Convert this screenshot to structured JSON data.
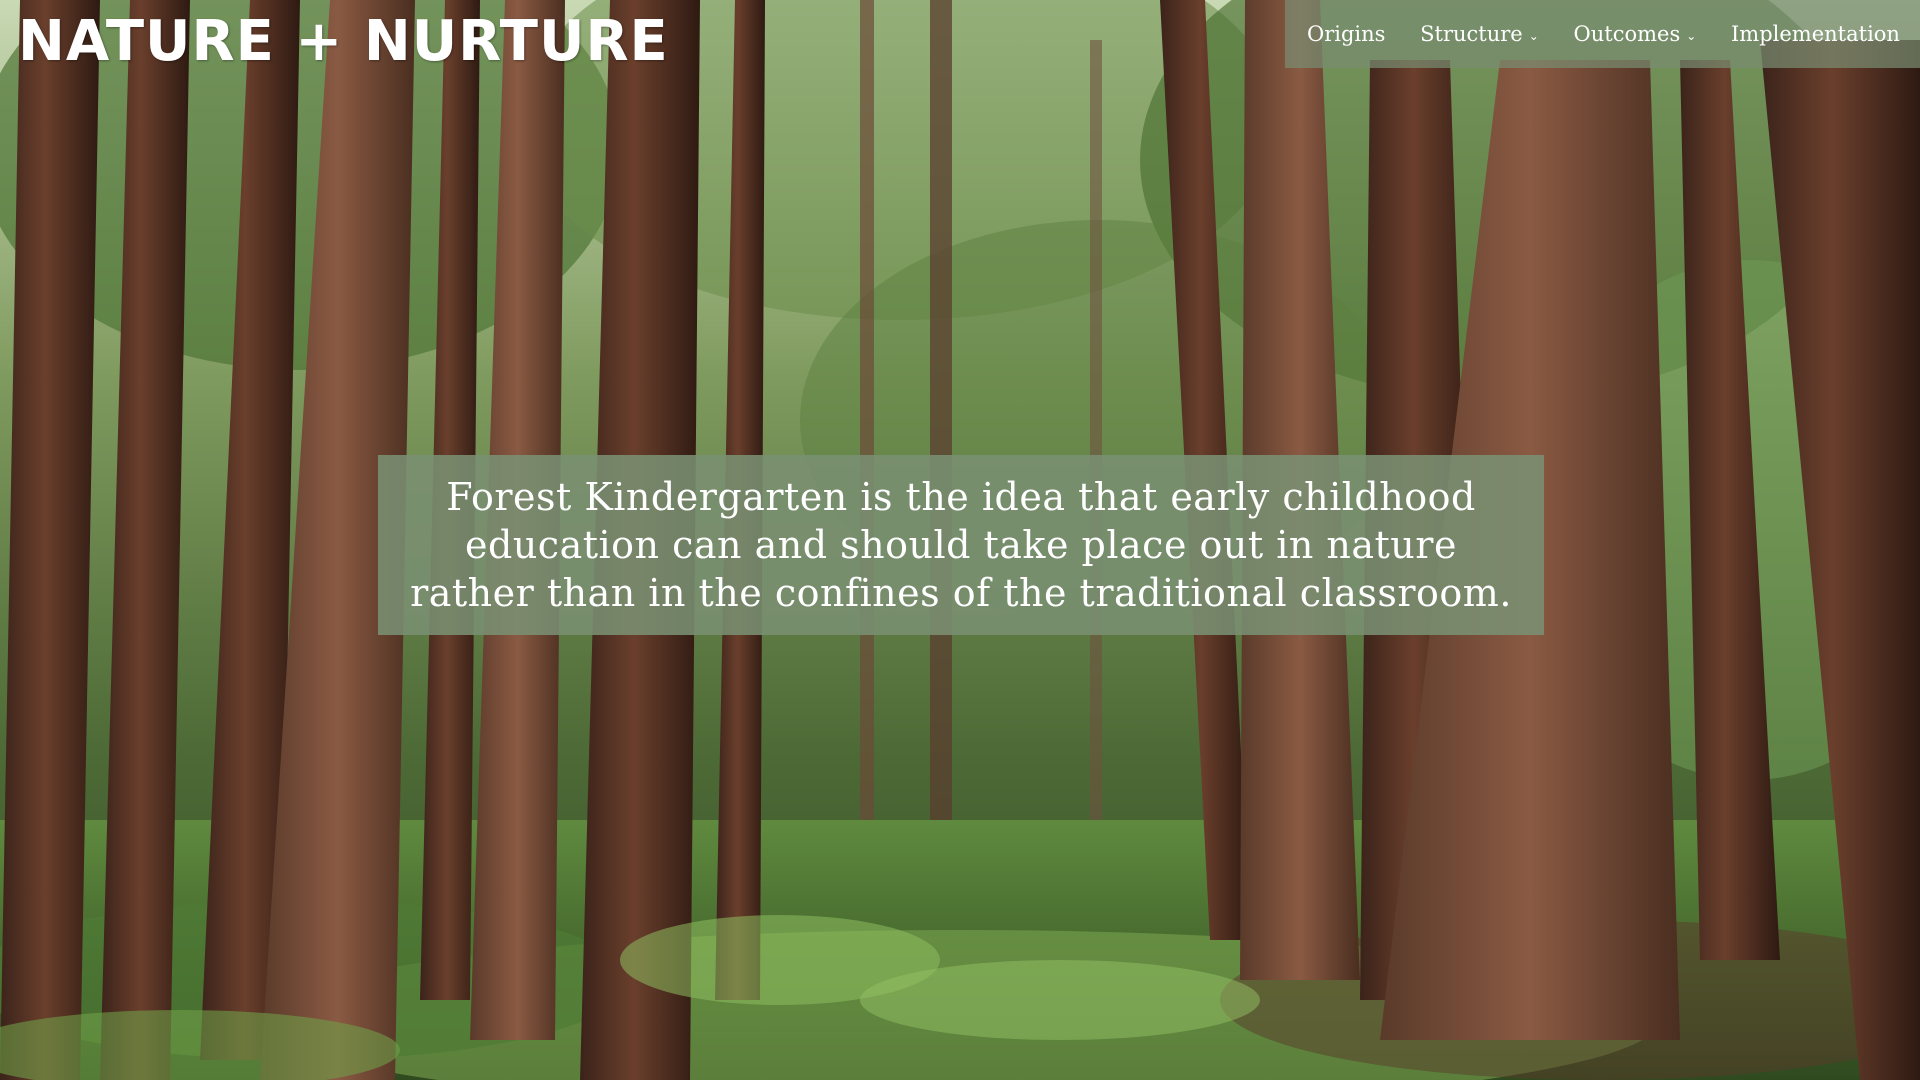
{
  "site": {
    "logo_text": "NATURE + NURTURE"
  },
  "nav": {
    "items": [
      {
        "label": "Origins",
        "icon": ""
      },
      {
        "label": "Structure",
        "icon": "chevron-down-icon"
      },
      {
        "label": "Outcomes",
        "icon": "chevron-down-icon"
      },
      {
        "label": "Implementation",
        "icon": ""
      }
    ]
  },
  "hero": {
    "tagline_lines": [
      "Forest Kindergarten is the idea that early childhood",
      "education can and should take place out in nature",
      "rather than in the confines of the traditional classroom."
    ],
    "background_icon": "redwood-forest-image"
  },
  "colors": {
    "overlay_green": "#7a8f72",
    "text": "#ffffff"
  }
}
